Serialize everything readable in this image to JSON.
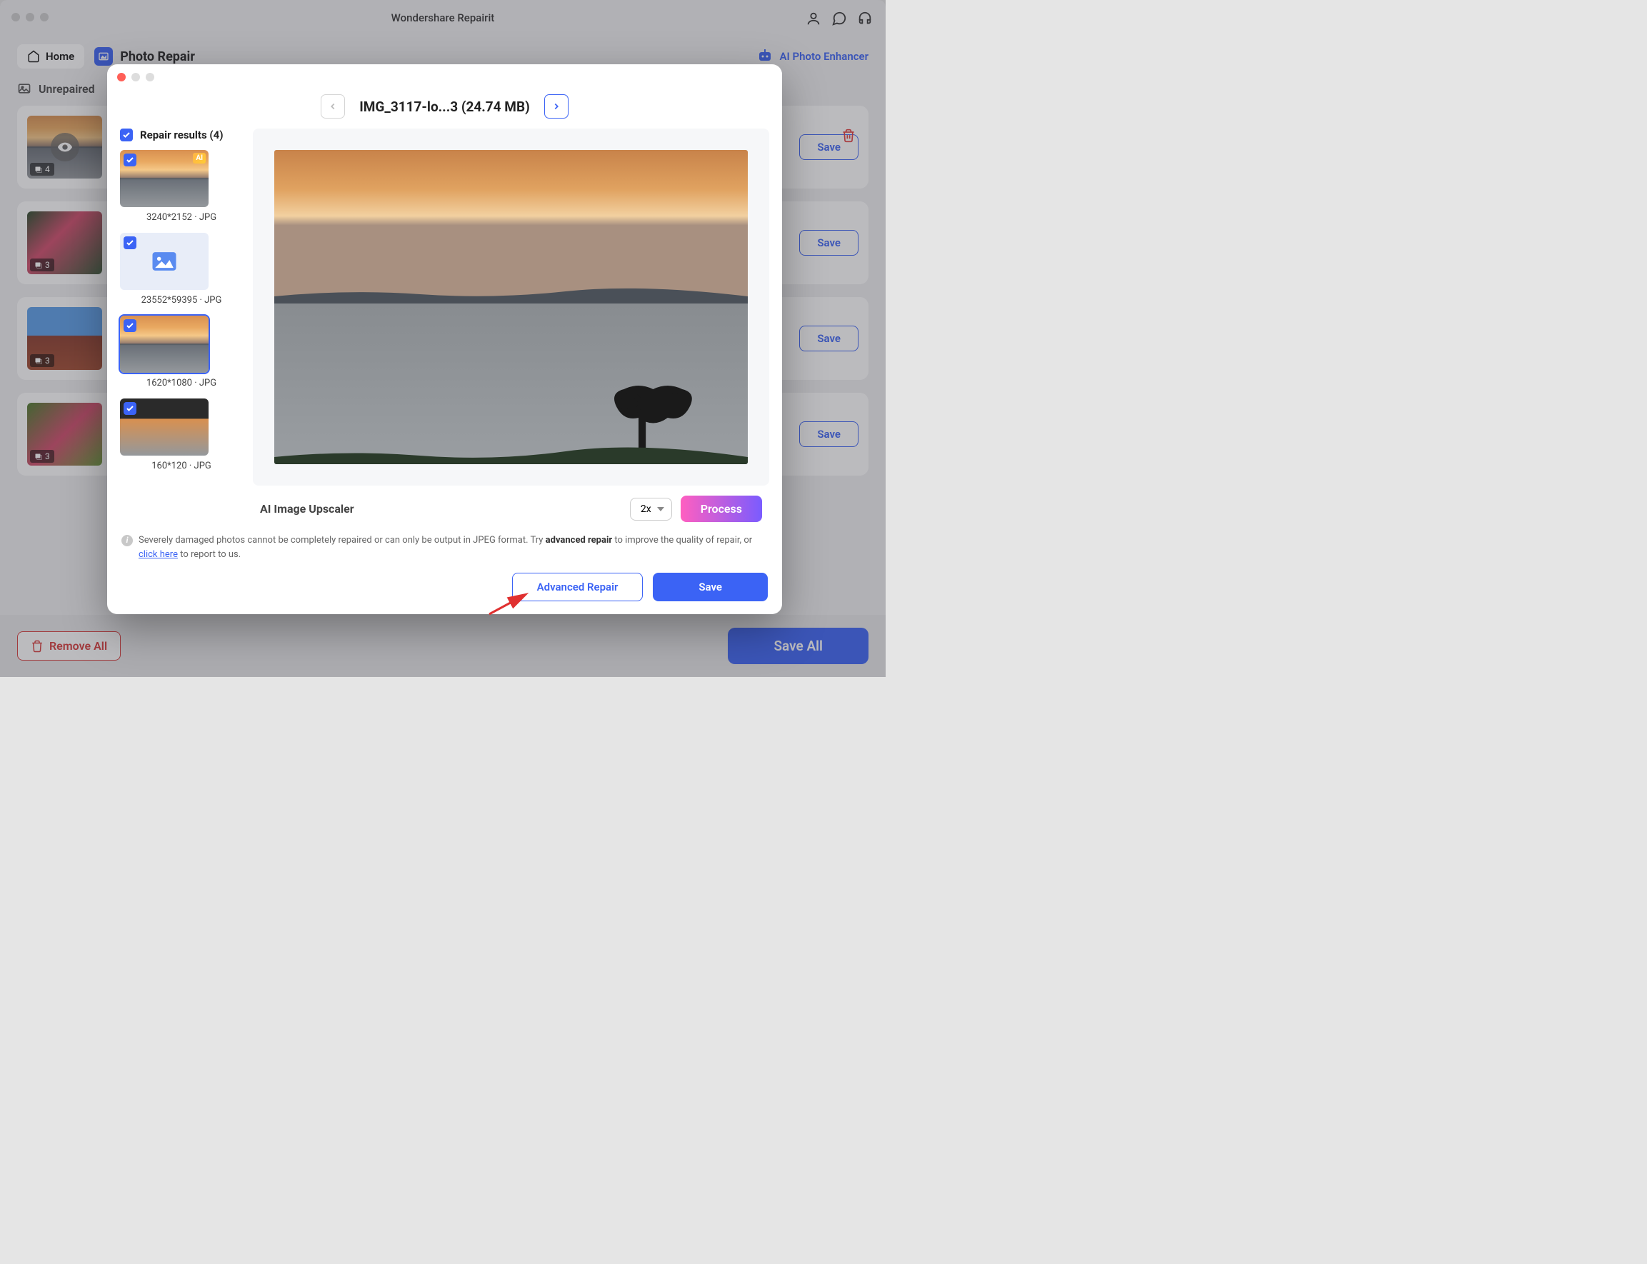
{
  "app": {
    "title": "Wondershare Repairit"
  },
  "toolbar": {
    "home": "Home",
    "section": "Photo Repair",
    "ai_enhancer": "AI Photo Enhancer"
  },
  "main": {
    "section_label": "Unrepaired",
    "thumbs": [
      {
        "count": "4"
      },
      {
        "count": "3"
      },
      {
        "count": "3"
      },
      {
        "count": "3"
      }
    ],
    "save": "Save"
  },
  "footer": {
    "remove_all": "Remove All",
    "save_all": "Save All"
  },
  "modal": {
    "file_title": "IMG_3117-lo...3 (24.74 MB)",
    "repair_results_label": "Repair results (4)",
    "results": [
      {
        "caption": "3240*2152 · JPG",
        "ai": true,
        "placeholder": false
      },
      {
        "caption": "23552*59395 · JPG",
        "ai": false,
        "placeholder": true
      },
      {
        "caption": "1620*1080 · JPG",
        "ai": false,
        "placeholder": false,
        "selected": true
      },
      {
        "caption": "160*120 · JPG",
        "ai": false,
        "placeholder": false
      }
    ],
    "upscaler_label": "AI Image Upscaler",
    "upscaler_value": "2x",
    "process": "Process",
    "note_pre": "Severely damaged photos cannot be completely repaired or can only be output in JPEG format. Try ",
    "note_strong": "advanced repair",
    "note_mid": " to improve the quality of repair, or ",
    "note_link": "click here",
    "note_post": " to report to us.",
    "adv_repair": "Advanced Repair",
    "save": "Save"
  }
}
